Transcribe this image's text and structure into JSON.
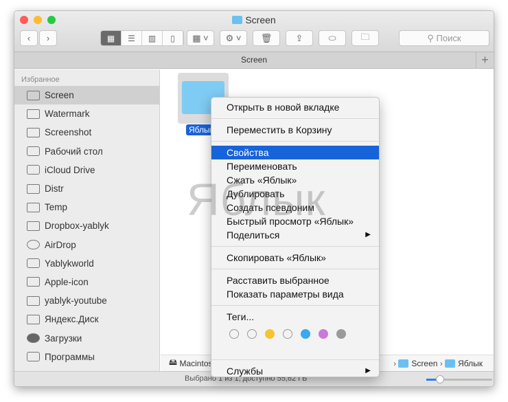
{
  "window": {
    "title": "Screen",
    "tab": "Screen",
    "search_placeholder": "Поиск"
  },
  "traffic_lights": [
    "#fc5d57",
    "#fdbb2e",
    "#27c940"
  ],
  "sidebar": {
    "heading": "Избранное",
    "items": [
      {
        "label": "Screen",
        "icon": "folder-icon",
        "selected": true
      },
      {
        "label": "Watermark",
        "icon": "folder-icon"
      },
      {
        "label": "Screenshot",
        "icon": "folder-icon"
      },
      {
        "label": "Рабочий стол",
        "icon": "desktop-icon"
      },
      {
        "label": "iCloud Drive",
        "icon": "cloud-icon"
      },
      {
        "label": "Distr",
        "icon": "folder-icon"
      },
      {
        "label": "Temp",
        "icon": "folder-icon"
      },
      {
        "label": "Dropbox-yablyk",
        "icon": "folder-icon"
      },
      {
        "label": "AirDrop",
        "icon": "airdrop-icon"
      },
      {
        "label": "Yablykworld",
        "icon": "home-icon"
      },
      {
        "label": "Apple-icon",
        "icon": "folder-icon"
      },
      {
        "label": "yablyk-youtube",
        "icon": "folder-icon"
      },
      {
        "label": "Яндекс.Диск",
        "icon": "folder-icon"
      },
      {
        "label": "Загрузки",
        "icon": "downloads-icon"
      },
      {
        "label": "Программы",
        "icon": "applications-icon"
      }
    ]
  },
  "file": {
    "name": "Яблык"
  },
  "pathbar": {
    "items": [
      "Macintosh HD",
      "Screen",
      "Яблык"
    ]
  },
  "status": {
    "text": "Выбрано 1 из 1; доступно 55,62 ГБ",
    "zoom_slider": 0.1
  },
  "context_menu": {
    "open_tab": "Открыть в новой вкладке",
    "trash": "Переместить в Корзину",
    "info": "Свойства",
    "rename": "Переименовать",
    "compress": "Сжать «Яблык»",
    "duplicate": "Дублировать",
    "alias": "Создать псевдоним",
    "quicklook": "Быстрый просмотр «Яблык»",
    "share": "Поделиться",
    "copy": "Скопировать «Яблык»",
    "arrange": "Расставить выбранное",
    "view_options": "Показать параметры вида",
    "tags": "Теги...",
    "tag_colors": [
      "none",
      "none",
      "#f5c431",
      "none",
      "#3aa9ee",
      "#c87ad9",
      "#9a9a9a"
    ],
    "services": "Службы"
  },
  "watermark": "Яблык"
}
